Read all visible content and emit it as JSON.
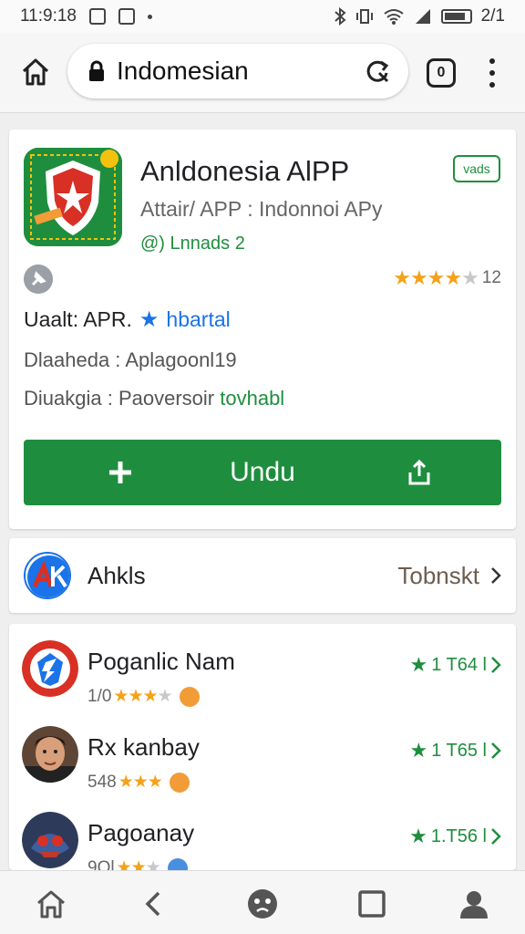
{
  "status_bar": {
    "time": "11:9:18",
    "battery": "2/1"
  },
  "address_bar": {
    "url": "Indomesian",
    "tabs_count": "0"
  },
  "app": {
    "title": "Anldonesia AlPP",
    "subtitle": "Attair/ APP : Indonnoi APy",
    "downloads": "@) Lnnads 2",
    "badge": "vads",
    "rating_value": "12",
    "rating_stars": 4,
    "developer_label": "Uaalt: APR.",
    "developer_link": "hbartal",
    "info1_label": "Dlaaheda :",
    "info1_value": "Aplagoonl19",
    "info2_label": "Diuakgia :",
    "info2_value": "Paoversoir",
    "info2_extra": "tovhabl",
    "install_label": "Undu"
  },
  "ads": {
    "title": "Ahkls",
    "link": "Tobnskt"
  },
  "list": [
    {
      "name": "Poganlic Nam",
      "sub": "1/0",
      "stars": 3,
      "score": "1 T64 l"
    },
    {
      "name": "Rx kanbay",
      "sub": "548",
      "stars": 3,
      "score": "1 T65 l"
    },
    {
      "name": "Pagoanay",
      "sub": "9Ol",
      "stars": 2,
      "score": "1.T56 l"
    }
  ],
  "colors": {
    "green": "#1e8e3e",
    "blue": "#1a73e8",
    "star": "#f4a21a"
  }
}
